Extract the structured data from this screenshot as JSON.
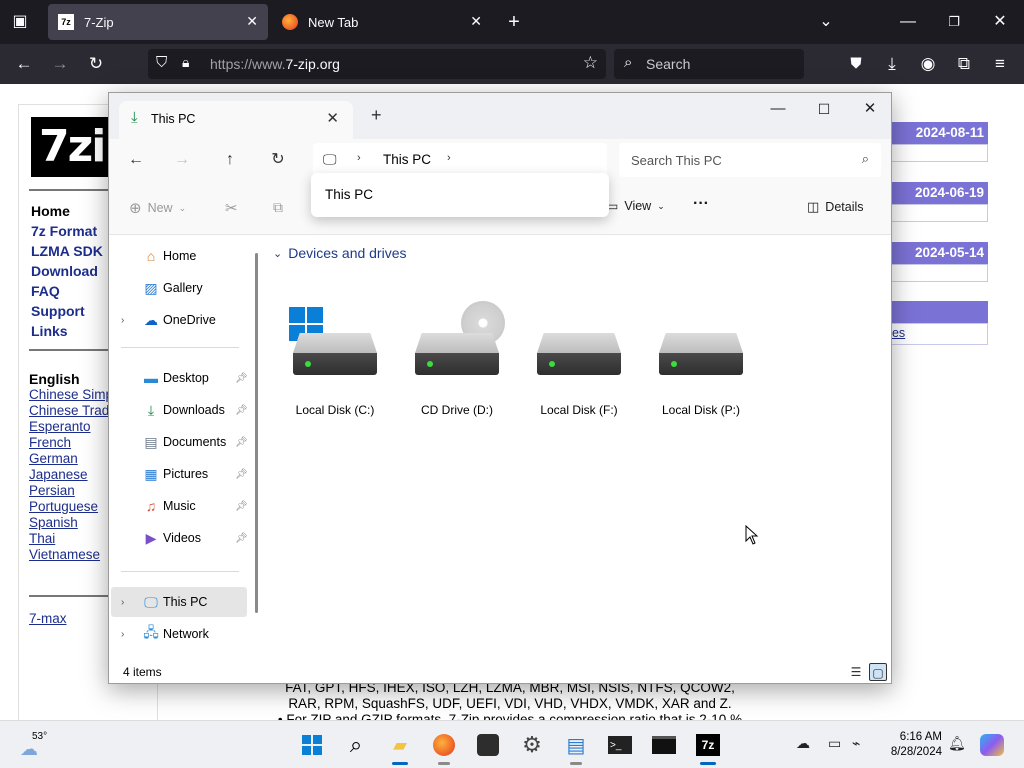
{
  "browser": {
    "tabs": [
      {
        "label": "7-Zip",
        "favicon": "7z"
      },
      {
        "label": "New Tab",
        "favicon": "firefox-icon"
      }
    ],
    "url_prefix": "https://www.",
    "url_domain": "7-zip.org",
    "search_placeholder": "Search"
  },
  "website": {
    "logo_text": "7zi",
    "nav": [
      "Home",
      "7z Format",
      "LZMA SDK",
      "Download",
      "FAQ",
      "Support",
      "Links"
    ],
    "lang_label": "English",
    "languages": [
      "Chinese Simp",
      "Chinese Trad",
      "Esperanto",
      "French",
      "German",
      "Japanese",
      "Persian",
      "Portuguese",
      "Spanish",
      "Thai",
      "Vietnamese"
    ],
    "extra_link": "7-max",
    "news_dates": [
      "2024-08-11",
      "2024-06-19",
      "2024-05-14"
    ],
    "news_link_text": "ges",
    "bottom_line1": "FAT, GPT, HFS, IHEX, ISO, LZH, LZMA, MBR, MSI, NSIS, NTFS, QCOW2,",
    "bottom_line2": "RAR, RPM, SquashFS, UDF, UEFI, VDI, VHD, VHDX, VMDK, XAR and Z.",
    "bottom_line3": "• For ZIP and GZIP formats, 7-Zip provides a compression ratio that is 2-10 %"
  },
  "explorer": {
    "tab_title": "This PC",
    "address_crumb": "This PC",
    "search_placeholder": "Search This PC",
    "dropdown_item": "This PC",
    "commands": {
      "new": "New",
      "view": "View",
      "details": "Details"
    },
    "sidebar": {
      "top": [
        {
          "label": "Home",
          "icon": "home-icon"
        },
        {
          "label": "Gallery",
          "icon": "gallery-icon"
        },
        {
          "label": "OneDrive",
          "icon": "onedrive-icon"
        }
      ],
      "pinned": [
        {
          "label": "Desktop",
          "icon": "desktop-icon"
        },
        {
          "label": "Downloads",
          "icon": "downloads-icon"
        },
        {
          "label": "Documents",
          "icon": "documents-icon"
        },
        {
          "label": "Pictures",
          "icon": "pictures-icon"
        },
        {
          "label": "Music",
          "icon": "music-icon"
        },
        {
          "label": "Videos",
          "icon": "videos-icon"
        }
      ],
      "bottom": [
        {
          "label": "This PC",
          "icon": "this-pc-icon"
        },
        {
          "label": "Network",
          "icon": "network-icon"
        }
      ]
    },
    "section_header": "Devices and drives",
    "drives": [
      {
        "label": "Local Disk (C:)",
        "type": "system"
      },
      {
        "label": "CD Drive (D:)",
        "type": "cd"
      },
      {
        "label": "Local Disk (F:)",
        "type": "disk"
      },
      {
        "label": "Local Disk (P:)",
        "type": "disk"
      }
    ],
    "status_count": "4 items"
  },
  "taskbar": {
    "weather_temp": "53°",
    "time": "6:16 AM",
    "date": "8/28/2024"
  },
  "colors": {
    "accent": "#0067c0",
    "site_nav": "#1c2d8c",
    "news_header": "#7b72d6"
  }
}
